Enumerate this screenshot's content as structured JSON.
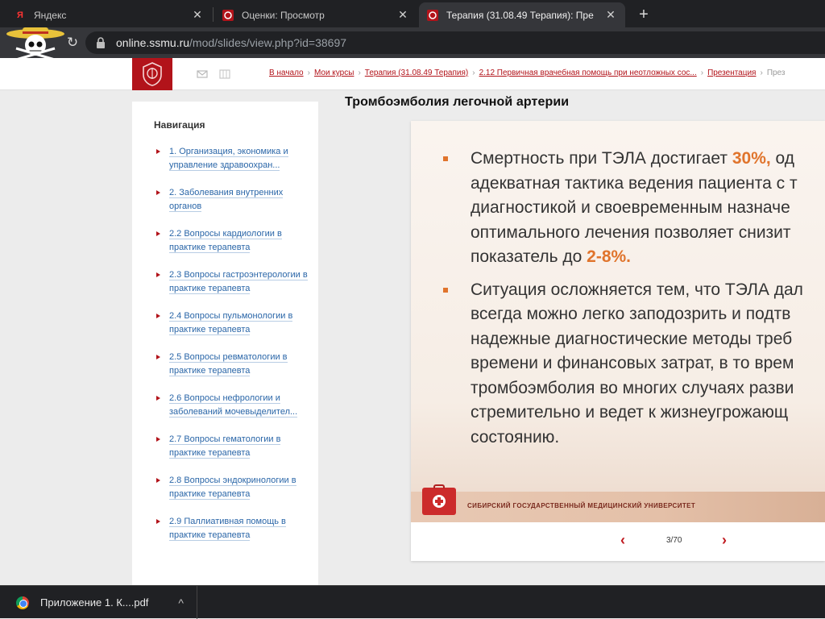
{
  "tabs": [
    {
      "title": "Яндекс",
      "favicon": "yandex-icon",
      "active": false
    },
    {
      "title": "Оценки: Просмотр",
      "favicon": "ssmu-crest-icon",
      "active": false
    },
    {
      "title": "Терапия (31.08.49 Терапия): Пре",
      "favicon": "ssmu-crest-icon",
      "active": true
    }
  ],
  "address": {
    "host": "online.ssmu.ru",
    "path": "/mod/slides/view.php?id=38697"
  },
  "breadcrumbs": [
    "В начало",
    "Мои курсы",
    "Терапия (31.08.49 Терапия)",
    "2.12 Первичная врачебная помощь при неотложных сос...",
    "Презентация",
    "През"
  ],
  "sidebar": {
    "title": "Навигация",
    "items": [
      {
        "label": "1. Организация, экономика и управление здравоохран..."
      },
      {
        "label": "2. Заболевания внутренних органов"
      },
      {
        "label": "2.2 Вопросы кардиологии в практике терапевта"
      },
      {
        "label": "2.3 Вопросы гастроэнтерологии в практике терапевта"
      },
      {
        "label": "2.4 Вопросы пульмонологии в практике терапевта"
      },
      {
        "label": "2.5 Вопросы ревматологии в практике терапевта"
      },
      {
        "label": "2.6 Вопросы нефрологии и заболеваний мочевыделител..."
      },
      {
        "label": "2.7 Вопросы гематологии в практике терапевта"
      },
      {
        "label": "2.8 Вопросы эндокринологии в практике терапевта"
      },
      {
        "label": "2.9 Паллиативная помощь в практике терапевта"
      }
    ]
  },
  "main": {
    "title": "Тромбоэмболия легочной артерии"
  },
  "slide": {
    "bullet1": {
      "line1_pre": "Смертность при ТЭЛА достигает ",
      "line1_hl": "30%,",
      "line1_post": " од",
      "line2": "адекватная тактика ведения пациента с т",
      "line3": "диагностикой и своевременным назначе",
      "line4": "оптимального лечения позволяет снизит",
      "line5_pre": "показатель до ",
      "line5_hl": "2-8%."
    },
    "bullet2": {
      "line1": "Ситуация осложняется тем, что ТЭЛА дал",
      "line2": "всегда можно легко заподозрить и подтв",
      "line3": "надежные диагностические методы треб",
      "line4": "времени и финансовых затрат, в то врем",
      "line5": "тромбоэмболия во многих случаях разви",
      "line6": "стремительно и ведет к жизнеугрожающ",
      "line7": "состоянию."
    },
    "footer_text": "СИБИРСКИЙ ГОСУДАРСТВЕННЫЙ МЕДИЦИНСКИЙ УНИВЕРСИТЕТ",
    "accent_color": "#e0742c"
  },
  "pager": {
    "label": "3/70",
    "prev": "‹",
    "next": "›"
  },
  "downloads": {
    "file": "Приложение 1. К....pdf",
    "chevron": "^"
  },
  "colors": {
    "brand_red": "#b2131a",
    "link_blue": "#2a66a8"
  }
}
